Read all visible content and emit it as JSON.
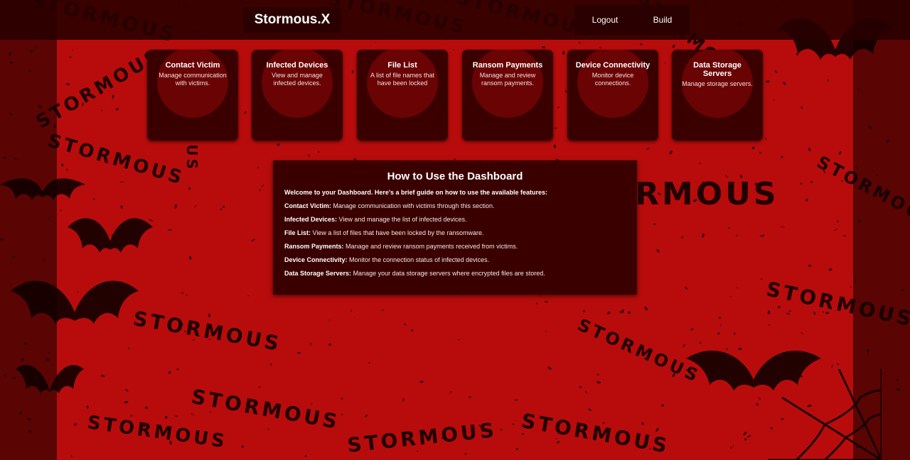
{
  "brand": {
    "title": "Stormous.X"
  },
  "nav": {
    "logout": "Logout",
    "build": "Build"
  },
  "cards": [
    {
      "title": "Contact Victim",
      "description": "Manage communication with victims."
    },
    {
      "title": "Infected Devices",
      "description": "View and manage infected devices."
    },
    {
      "title": "File List",
      "description": "A list of file names that have been locked"
    },
    {
      "title": "Ransom Payments",
      "description": "Manage and review ransom payments."
    },
    {
      "title": "Device Connectivity",
      "description": "Monitor device connections."
    },
    {
      "title": "Data Storage Servers",
      "description": "Manage storage servers."
    }
  ],
  "guide": {
    "title": "How to Use the Dashboard",
    "intro": "Welcome to your Dashboard. Here's a brief guide on how to use the available features:",
    "items": [
      {
        "term": "Contact Victim:",
        "text": "Manage communication with victims through this section."
      },
      {
        "term": "Infected Devices:",
        "text": "View and manage the list of infected devices."
      },
      {
        "term": "File List:",
        "text": "View a list of files that have been locked by the ransomware."
      },
      {
        "term": "Ransom Payments:",
        "text": "Manage and review ransom payments received from victims."
      },
      {
        "term": "Device Connectivity:",
        "text": "Monitor the connection status of infected devices."
      },
      {
        "term": "Data Storage Servers:",
        "text": "Manage your data storage servers where encrypted files are stored."
      }
    ]
  },
  "background": {
    "watermark_text": "STORMOUS",
    "colors": {
      "red": "#b80c0c",
      "dark": "#3a0000",
      "side": "#5a0404"
    }
  }
}
